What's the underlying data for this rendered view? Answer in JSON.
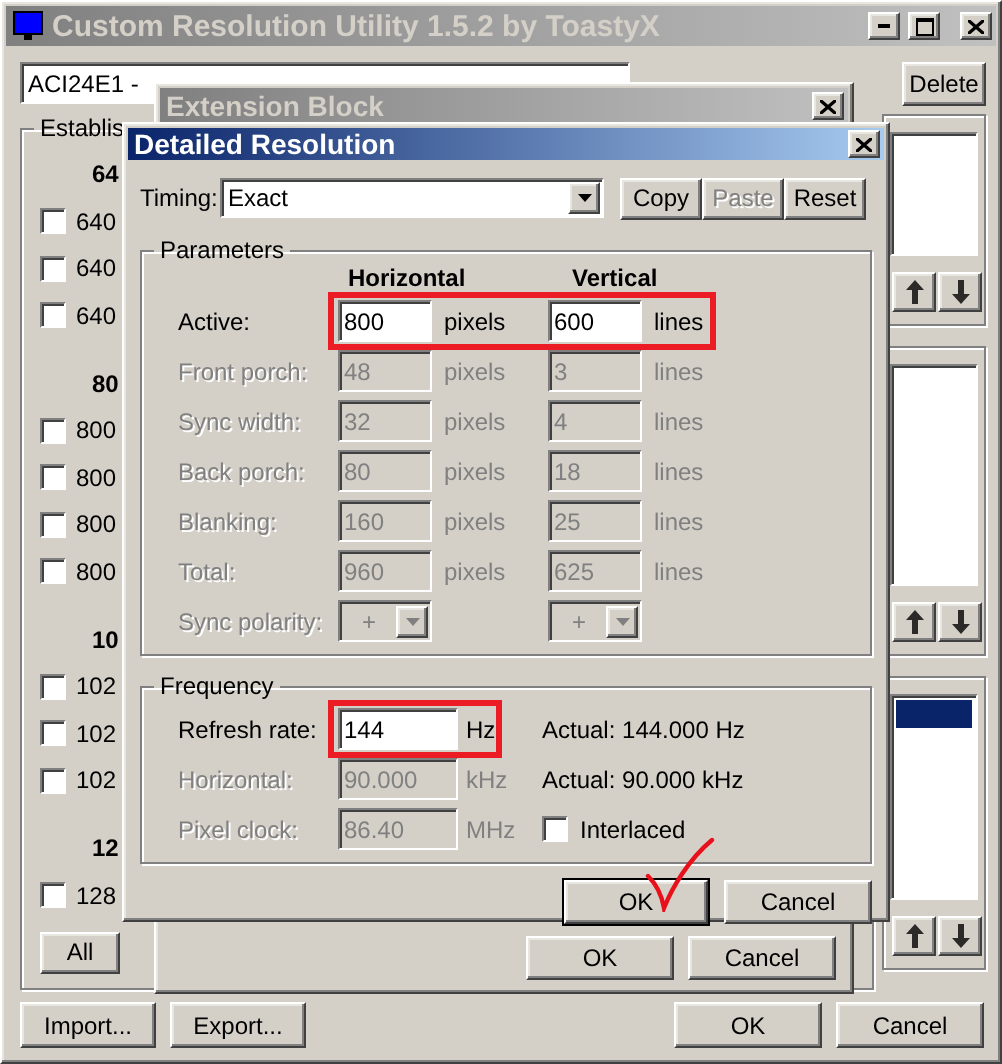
{
  "main_window": {
    "title": "Custom Resolution Utility 1.5.2 by ToastyX",
    "monitor": "ACI24E1 -",
    "top_buttons": [
      {
        "label": "Delete",
        "disabled": false
      }
    ],
    "established": {
      "title": "Establis",
      "items": [
        {
          "kind": "header",
          "label": "64"
        },
        {
          "kind": "checkbox",
          "label": "640",
          "checked": false
        },
        {
          "kind": "checkbox",
          "label": "640",
          "checked": false
        },
        {
          "kind": "checkbox",
          "label": "640",
          "checked": false
        },
        {
          "kind": "header",
          "label": "80"
        },
        {
          "kind": "checkbox",
          "label": "800",
          "checked": false
        },
        {
          "kind": "checkbox",
          "label": "800",
          "checked": false
        },
        {
          "kind": "checkbox",
          "label": "800",
          "checked": false
        },
        {
          "kind": "checkbox",
          "label": "800",
          "checked": false
        },
        {
          "kind": "header",
          "label": "10"
        },
        {
          "kind": "checkbox",
          "label": "102",
          "checked": false
        },
        {
          "kind": "checkbox",
          "label": "102",
          "checked": false
        },
        {
          "kind": "checkbox",
          "label": "102",
          "checked": false
        },
        {
          "kind": "header",
          "label": "12"
        },
        {
          "kind": "checkbox",
          "label": "128",
          "checked": false
        }
      ],
      "buttons": [
        "All"
      ]
    },
    "lists": [
      {
        "selection": false
      },
      {
        "selection": false
      },
      {
        "selection": true
      }
    ],
    "bottom_left_buttons": [
      "Import...",
      "Export..."
    ],
    "bottom_right_buttons": [
      "OK",
      "Cancel"
    ]
  },
  "extension_block": {
    "title": "Extension Block",
    "buttons": [
      "OK",
      "Cancel"
    ]
  },
  "detailed_resolution": {
    "title": "Detailed Resolution",
    "timing": {
      "label": "Timing:",
      "value": "Exact"
    },
    "timing_buttons": [
      {
        "label": "Copy",
        "disabled": false
      },
      {
        "label": "Paste",
        "disabled": true
      },
      {
        "label": "Reset",
        "disabled": false
      }
    ],
    "parameters": {
      "title": "Parameters",
      "columns": [
        "Horizontal",
        "Vertical"
      ],
      "rows": [
        {
          "kind": "fields",
          "label": "Active:",
          "disabled": false,
          "highlighted": true,
          "horizontal": "800",
          "horizontal_unit": "pixels",
          "vertical": "600",
          "vertical_unit": "lines"
        },
        {
          "kind": "fields",
          "label": "Front porch:",
          "disabled": true,
          "highlighted": false,
          "horizontal": "48",
          "horizontal_unit": "pixels",
          "vertical": "3",
          "vertical_unit": "lines"
        },
        {
          "kind": "fields",
          "label": "Sync width:",
          "disabled": true,
          "highlighted": false,
          "horizontal": "32",
          "horizontal_unit": "pixels",
          "vertical": "4",
          "vertical_unit": "lines"
        },
        {
          "kind": "fields",
          "label": "Back porch:",
          "disabled": true,
          "highlighted": false,
          "horizontal": "80",
          "horizontal_unit": "pixels",
          "vertical": "18",
          "vertical_unit": "lines"
        },
        {
          "kind": "fields",
          "label": "Blanking:",
          "disabled": true,
          "highlighted": false,
          "horizontal": "160",
          "horizontal_unit": "pixels",
          "vertical": "25",
          "vertical_unit": "lines"
        },
        {
          "kind": "fields",
          "label": "Total:",
          "disabled": true,
          "highlighted": false,
          "horizontal": "960",
          "horizontal_unit": "pixels",
          "vertical": "625",
          "vertical_unit": "lines"
        },
        {
          "kind": "select",
          "label": "Sync polarity:",
          "disabled": true,
          "highlighted": false,
          "horizontal": "+",
          "vertical": "+"
        }
      ]
    },
    "frequency": {
      "title": "Frequency",
      "rows": [
        {
          "label": "Refresh rate:",
          "value": "144",
          "unit": "Hz",
          "disabled": false,
          "highlighted": true,
          "note": "Actual: 144.000 Hz"
        },
        {
          "label": "Horizontal:",
          "value": "90.000",
          "unit": "kHz",
          "disabled": true,
          "highlighted": false,
          "note": "Actual: 90.000 kHz"
        },
        {
          "label": "Pixel clock:",
          "value": "86.40",
          "unit": "MHz",
          "disabled": true,
          "highlighted": false,
          "checkbox": {
            "label": "Interlaced",
            "checked": false
          }
        }
      ]
    },
    "buttons": [
      {
        "label": "OK",
        "default": true,
        "marked": true
      },
      {
        "label": "Cancel",
        "default": false,
        "marked": false
      }
    ]
  }
}
